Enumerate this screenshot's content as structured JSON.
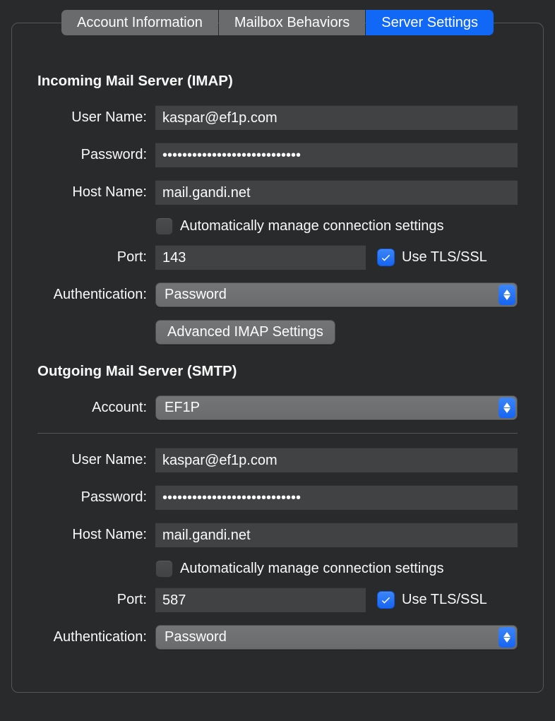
{
  "tabs": {
    "account_info": "Account Information",
    "mailbox_behaviors": "Mailbox Behaviors",
    "server_settings": "Server Settings"
  },
  "incoming": {
    "title": "Incoming Mail Server (IMAP)",
    "labels": {
      "username": "User Name:",
      "password": "Password:",
      "hostname": "Host Name:",
      "port": "Port:",
      "authentication": "Authentication:"
    },
    "username": "kaspar@ef1p.com",
    "password": "••••••••••••••••••••••••••••",
    "hostname": "mail.gandi.net",
    "auto_manage_label": "Automatically manage connection settings",
    "auto_manage_checked": false,
    "port": "143",
    "use_tls_label": "Use TLS/SSL",
    "use_tls_checked": true,
    "authentication": "Password",
    "advanced_button": "Advanced IMAP Settings"
  },
  "outgoing": {
    "title": "Outgoing Mail Server (SMTP)",
    "labels": {
      "account": "Account:",
      "username": "User Name:",
      "password": "Password:",
      "hostname": "Host Name:",
      "port": "Port:",
      "authentication": "Authentication:"
    },
    "account": "EF1P",
    "username": "kaspar@ef1p.com",
    "password": "••••••••••••••••••••••••••••",
    "hostname": "mail.gandi.net",
    "auto_manage_label": "Automatically manage connection settings",
    "auto_manage_checked": false,
    "port": "587",
    "use_tls_label": "Use TLS/SSL",
    "use_tls_checked": true,
    "authentication": "Password"
  }
}
